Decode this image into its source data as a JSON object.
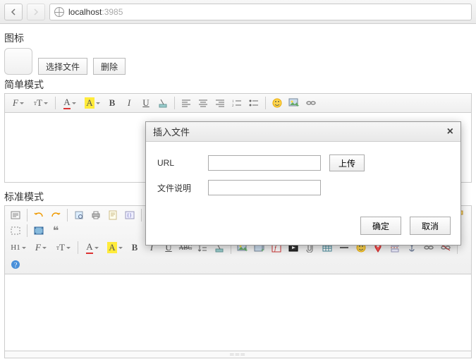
{
  "browser": {
    "host": "localhost",
    "port": ":3985"
  },
  "labels": {
    "icon_section": "图标",
    "choose_file": "选择文件",
    "delete": "删除",
    "simple_mode": "简单模式",
    "standard_mode": "标准模式"
  },
  "dialog": {
    "title": "插入文件",
    "url_label": "URL",
    "desc_label": "文件说明",
    "upload": "上传",
    "ok": "确定",
    "cancel": "取消",
    "url_value": "",
    "desc_value": ""
  },
  "simple_toolbar": {
    "font_family": "F",
    "font_size": "T",
    "fg": "A",
    "bg": "A",
    "bold": "B",
    "italic": "I",
    "underline": "U"
  },
  "std_toolbar": {
    "heading": "H1",
    "font_family": "F",
    "font_size": "T",
    "fg": "A",
    "bg": "A",
    "bold": "B",
    "italic": "I",
    "underline": "U",
    "strike": "ABC"
  }
}
